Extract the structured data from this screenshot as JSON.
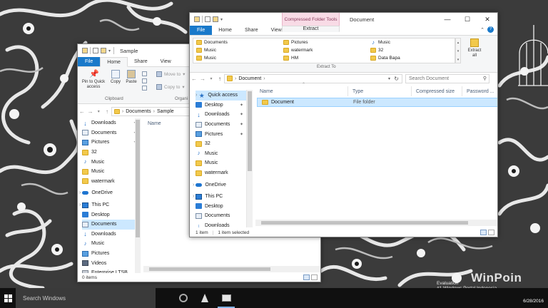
{
  "desktop": {
    "brand": "WinPoin",
    "watermark_line1": "Evaluation",
    "watermark_line2": "#1 Windows Portal Indonesia",
    "clock_date": "6/28/2016"
  },
  "taskbar": {
    "search_placeholder": "Search Windows"
  },
  "sample_window": {
    "title": "Sample",
    "tabs": [
      "File",
      "Home",
      "Share",
      "View"
    ],
    "active_tab": "Home",
    "ribbon": {
      "pin_label": "Pin to Quick access",
      "copy_label": "Copy",
      "paste_label": "Paste",
      "move_to": "Move to",
      "copy_to": "Copy to",
      "group_clipboard": "Clipboard",
      "group_organize": "Organi"
    },
    "breadcrumb": [
      "Documents",
      "Sample"
    ],
    "nav_items": [
      {
        "label": "Downloads",
        "icon": "download-icon",
        "pinned": true
      },
      {
        "label": "Documents",
        "icon": "documents-icon",
        "pinned": true
      },
      {
        "label": "Pictures",
        "icon": "pictures-icon",
        "pinned": true
      },
      {
        "label": "32",
        "icon": "folder-icon",
        "pinned": false
      },
      {
        "label": "Music",
        "icon": "music-icon",
        "pinned": false
      },
      {
        "label": "Music",
        "icon": "folder-icon",
        "pinned": false
      },
      {
        "label": "watermark",
        "icon": "folder-icon",
        "pinned": false
      },
      {
        "label": "OneDrive",
        "icon": "onedrive-icon",
        "pinned": false
      },
      {
        "label": "This PC",
        "icon": "pc-icon",
        "pinned": false
      },
      {
        "label": "Desktop",
        "icon": "desktop-icon",
        "pinned": false
      },
      {
        "label": "Documents",
        "icon": "documents-icon",
        "pinned": false
      },
      {
        "label": "Downloads",
        "icon": "download-icon",
        "pinned": false
      },
      {
        "label": "Music",
        "icon": "music-icon",
        "pinned": false
      },
      {
        "label": "Pictures",
        "icon": "pictures-icon",
        "pinned": false
      },
      {
        "label": "Videos",
        "icon": "videos-icon",
        "pinned": false
      },
      {
        "label": "Enterprise LTSB",
        "icon": "drive-icon",
        "pinned": false
      }
    ],
    "selected_nav_index": 10,
    "column_name": "Name",
    "status": "0 items"
  },
  "document_window": {
    "title": "Document",
    "context_tab_group": "Compressed Folder Tools",
    "tabs": [
      "File",
      "Home",
      "Share",
      "View"
    ],
    "context_tab": "Extract",
    "extract_to_items": [
      [
        "Documents",
        "Pictures",
        "Music"
      ],
      [
        "Music",
        "watermark",
        "32"
      ],
      [
        "Music",
        "HM",
        "Data Bapa"
      ]
    ],
    "extract_to_label": "Extract To",
    "extract_all_line1": "Extract",
    "extract_all_line2": "all",
    "breadcrumb": "Document",
    "search_placeholder": "Search Document",
    "nav_items": [
      {
        "label": "Quick access",
        "icon": "star-icon",
        "pinned": false
      },
      {
        "label": "Desktop",
        "icon": "desktop-icon",
        "pinned": true
      },
      {
        "label": "Downloads",
        "icon": "download-icon",
        "pinned": true
      },
      {
        "label": "Documents",
        "icon": "documents-icon",
        "pinned": true
      },
      {
        "label": "Pictures",
        "icon": "pictures-icon",
        "pinned": true
      },
      {
        "label": "32",
        "icon": "folder-icon",
        "pinned": false
      },
      {
        "label": "Music",
        "icon": "music-icon",
        "pinned": false
      },
      {
        "label": "Music",
        "icon": "folder-icon",
        "pinned": false
      },
      {
        "label": "watermark",
        "icon": "folder-icon",
        "pinned": false
      },
      {
        "label": "OneDrive",
        "icon": "onedrive-icon",
        "pinned": false
      },
      {
        "label": "This PC",
        "icon": "pc-icon",
        "pinned": false
      },
      {
        "label": "Desktop",
        "icon": "desktop-icon",
        "pinned": false
      },
      {
        "label": "Documents",
        "icon": "documents-icon",
        "pinned": false
      },
      {
        "label": "Downloads",
        "icon": "download-icon",
        "pinned": false
      }
    ],
    "selected_nav_index": 0,
    "columns": [
      "Name",
      "Type",
      "Compressed size",
      "Password ..."
    ],
    "rows": [
      {
        "name": "Document",
        "type": "File folder"
      }
    ],
    "status_items": "1 item",
    "status_selected": "1 item selected"
  }
}
